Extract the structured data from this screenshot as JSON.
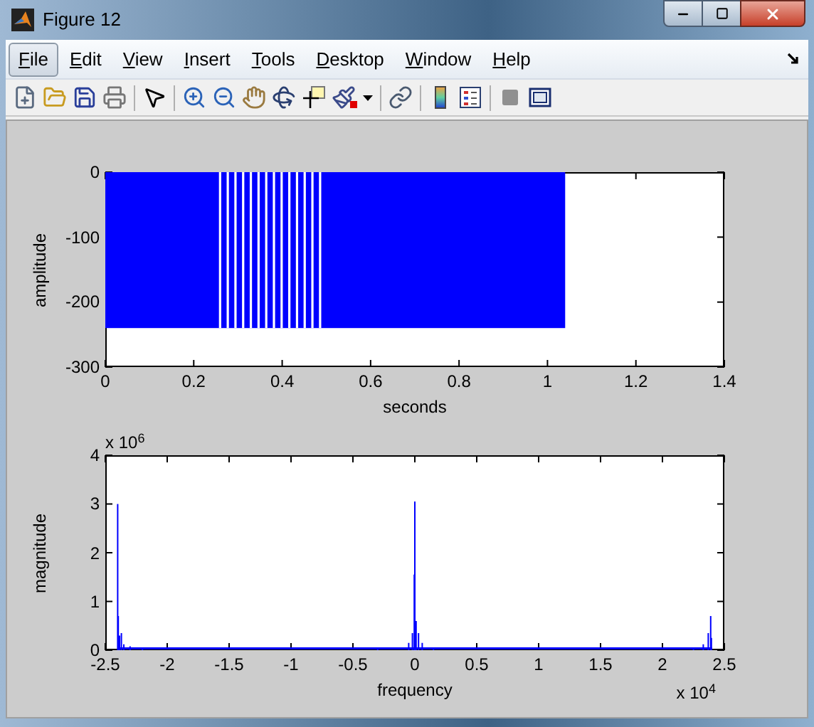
{
  "window": {
    "title": "Figure 12"
  },
  "menu": [
    {
      "label": "File",
      "highlighted": true
    },
    {
      "label": "Edit",
      "highlighted": false
    },
    {
      "label": "View",
      "highlighted": false
    },
    {
      "label": "Insert",
      "highlighted": false
    },
    {
      "label": "Tools",
      "highlighted": false
    },
    {
      "label": "Desktop",
      "highlighted": false
    },
    {
      "label": "Window",
      "highlighted": false
    },
    {
      "label": "Help",
      "highlighted": false
    }
  ],
  "plots": [
    {
      "kind": "waveform",
      "ylabel": "amplitude",
      "xlabel": "seconds",
      "yticks": [
        "0",
        "-100",
        "-200",
        "-300"
      ],
      "xticks": [
        "0",
        "0.2",
        "0.4",
        "0.6",
        "0.8",
        "1",
        "1.2",
        "1.4"
      ]
    },
    {
      "kind": "spectrum",
      "ylabel": "magnitude",
      "xlabel": "frequency",
      "y_exponent": "x 10$^{6}$",
      "x_exponent": "x 10$^{4}$",
      "yticks": [
        "4",
        "3",
        "2",
        "1",
        "0"
      ],
      "xticks": [
        "-2.5",
        "-2",
        "-1.5",
        "-1",
        "-0.5",
        "0",
        "0.5",
        "1",
        "1.5",
        "2",
        "2.5"
      ]
    }
  ]
}
